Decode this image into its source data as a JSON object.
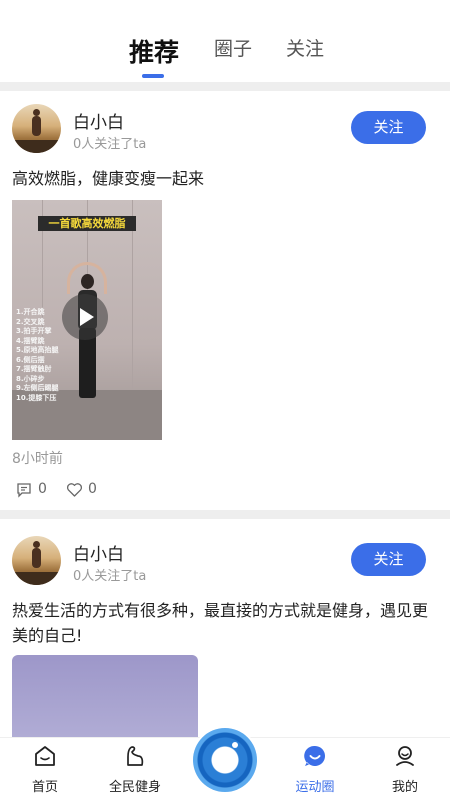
{
  "tabs": [
    {
      "label": "推荐",
      "active": true
    },
    {
      "label": "圈子",
      "active": false
    },
    {
      "label": "关注",
      "active": false
    }
  ],
  "accent_color": "#3b6ee8",
  "posts": [
    {
      "username": "白小白",
      "followers": "0人关注了ta",
      "follow_label": "关注",
      "text": "高效燃脂，健康变瘦一起来",
      "video": {
        "banner": "一首歌高效燃脂",
        "list": [
          "1.开合跳",
          "2.交叉跳",
          "3.拍手开掌",
          "4.摆臂跳",
          "5.原地高抬腿",
          "6.侧后摆",
          "7.摆臂触肘",
          "8.小碎步",
          "9.左侧后踢腿",
          "10.提膝下压"
        ]
      },
      "time": "8小时前",
      "comments": "0",
      "likes": "0"
    },
    {
      "username": "白小白",
      "followers": "0人关注了ta",
      "follow_label": "关注",
      "text": "热爱生活的方式有很多种，最直接的方式就是健身，遇见更美的自己!"
    }
  ],
  "nav": [
    {
      "label": "首页",
      "icon": "home-icon",
      "active": false
    },
    {
      "label": "全民健身",
      "icon": "arm-muscle-icon",
      "active": false
    },
    {
      "label": "运动圈",
      "icon": "smile-chat-icon",
      "active": true
    },
    {
      "label": "我的",
      "icon": "user-icon",
      "active": false
    }
  ]
}
